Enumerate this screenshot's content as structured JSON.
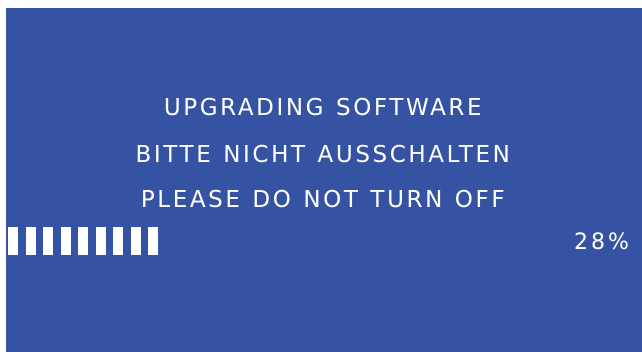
{
  "screen": {
    "background_color": "#3552a3",
    "text_color": "#ffffff",
    "messages": [
      "UPGRADING SOFTWARE",
      "BITTE NICHT AUSSCHALTEN",
      "PLEASE DO NOT TURN OFF"
    ]
  },
  "progress": {
    "percent_label": "28%",
    "value": 0.28,
    "filled_segments": 9
  }
}
